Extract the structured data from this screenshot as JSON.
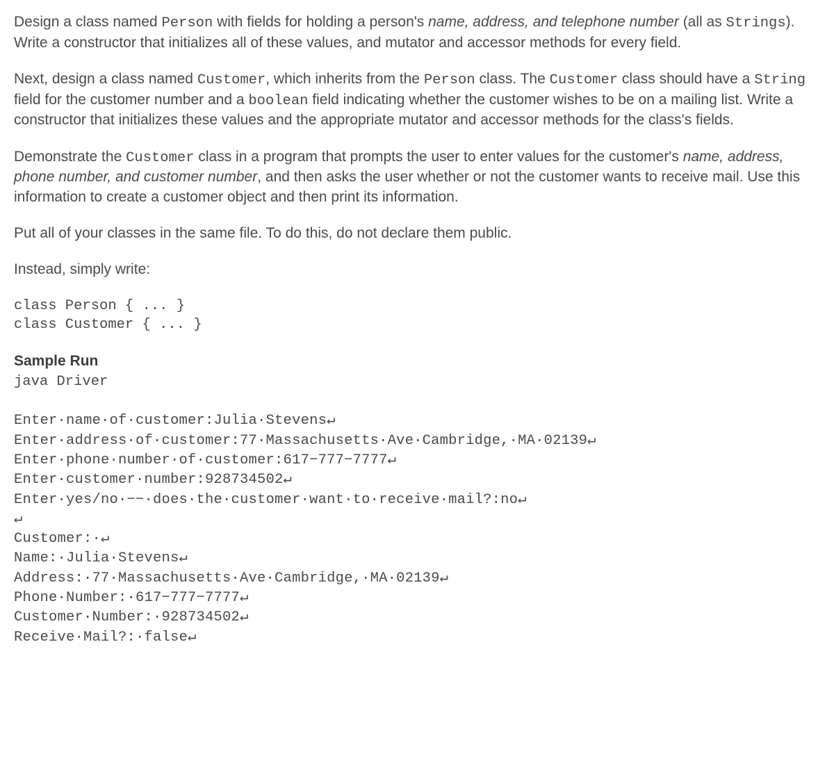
{
  "para1": {
    "pre1": "Design a class named ",
    "code1": "Person",
    "mid1": " with fields for holding a person's ",
    "italic1": "name, address, and telephone number",
    "mid2": " (all as ",
    "code2": "Strings",
    "post": "). Write a constructor that initializes all of these values, and mutator and accessor methods for every field."
  },
  "para2": {
    "pre1": "Next, design a class named ",
    "code1": "Customer",
    "mid1": ", which inherits from the ",
    "code2": "Person",
    "mid2": " class. The ",
    "code3": "Customer",
    "mid3": " class should have a ",
    "code4": "String",
    "mid4": " field for the customer number and a ",
    "code5": "boolean",
    "post": " field indicating whether the customer wishes to be on a mailing list. Write a constructor that initializes these values and the appropriate mutator and accessor methods for the class's fields."
  },
  "para3": {
    "pre1": "Demonstrate the ",
    "code1": "Customer",
    "mid1": " class in a program that prompts the user to enter values for the customer's ",
    "italic1": "name, address, phone number, and customer number",
    "post": ", and then asks the user whether or not the customer wants to receive mail. Use this information to create a customer object and then print its information."
  },
  "para4": "Put all of your classes in the same file. To do this, do not declare them public.",
  "para5": "Instead, simply write:",
  "codeblock": "class Person { ... }\nclass Customer { ... }",
  "sample_label": "Sample Run",
  "sample_cmd": "java Driver",
  "sample_run": "Enter·name·of·customer:Julia·Stevens↵\nEnter·address·of·customer:77·Massachusetts·Ave·Cambridge,·MA·02139↵\nEnter·phone·number·of·customer:617−777−7777↵\nEnter·customer·number:928734502↵\nEnter·yes/no·−−·does·the·customer·want·to·receive·mail?:no↵\n↵\nCustomer:·↵\nName:·Julia·Stevens↵\nAddress:·77·Massachusetts·Ave·Cambridge,·MA·02139↵\nPhone·Number:·617−777−7777↵\nCustomer·Number:·928734502↵\nReceive·Mail?:·false↵"
}
